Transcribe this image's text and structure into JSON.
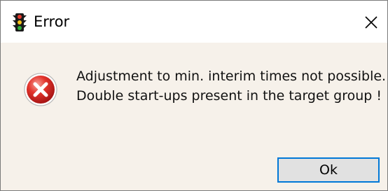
{
  "window": {
    "title": "Error",
    "icon": "traffic-light-icon",
    "close_icon": "close-icon"
  },
  "dialog": {
    "icon": "error-icon",
    "message_lines": [
      "Adjustment to min. interim times not possible.",
      "Double start-ups present in the target group !"
    ],
    "ok_label": "Ok"
  },
  "colors": {
    "title_background": "#ffffff",
    "body_background": "#f6f1ea",
    "button_border": "#0078d7",
    "error_red": "#d11f1f"
  }
}
